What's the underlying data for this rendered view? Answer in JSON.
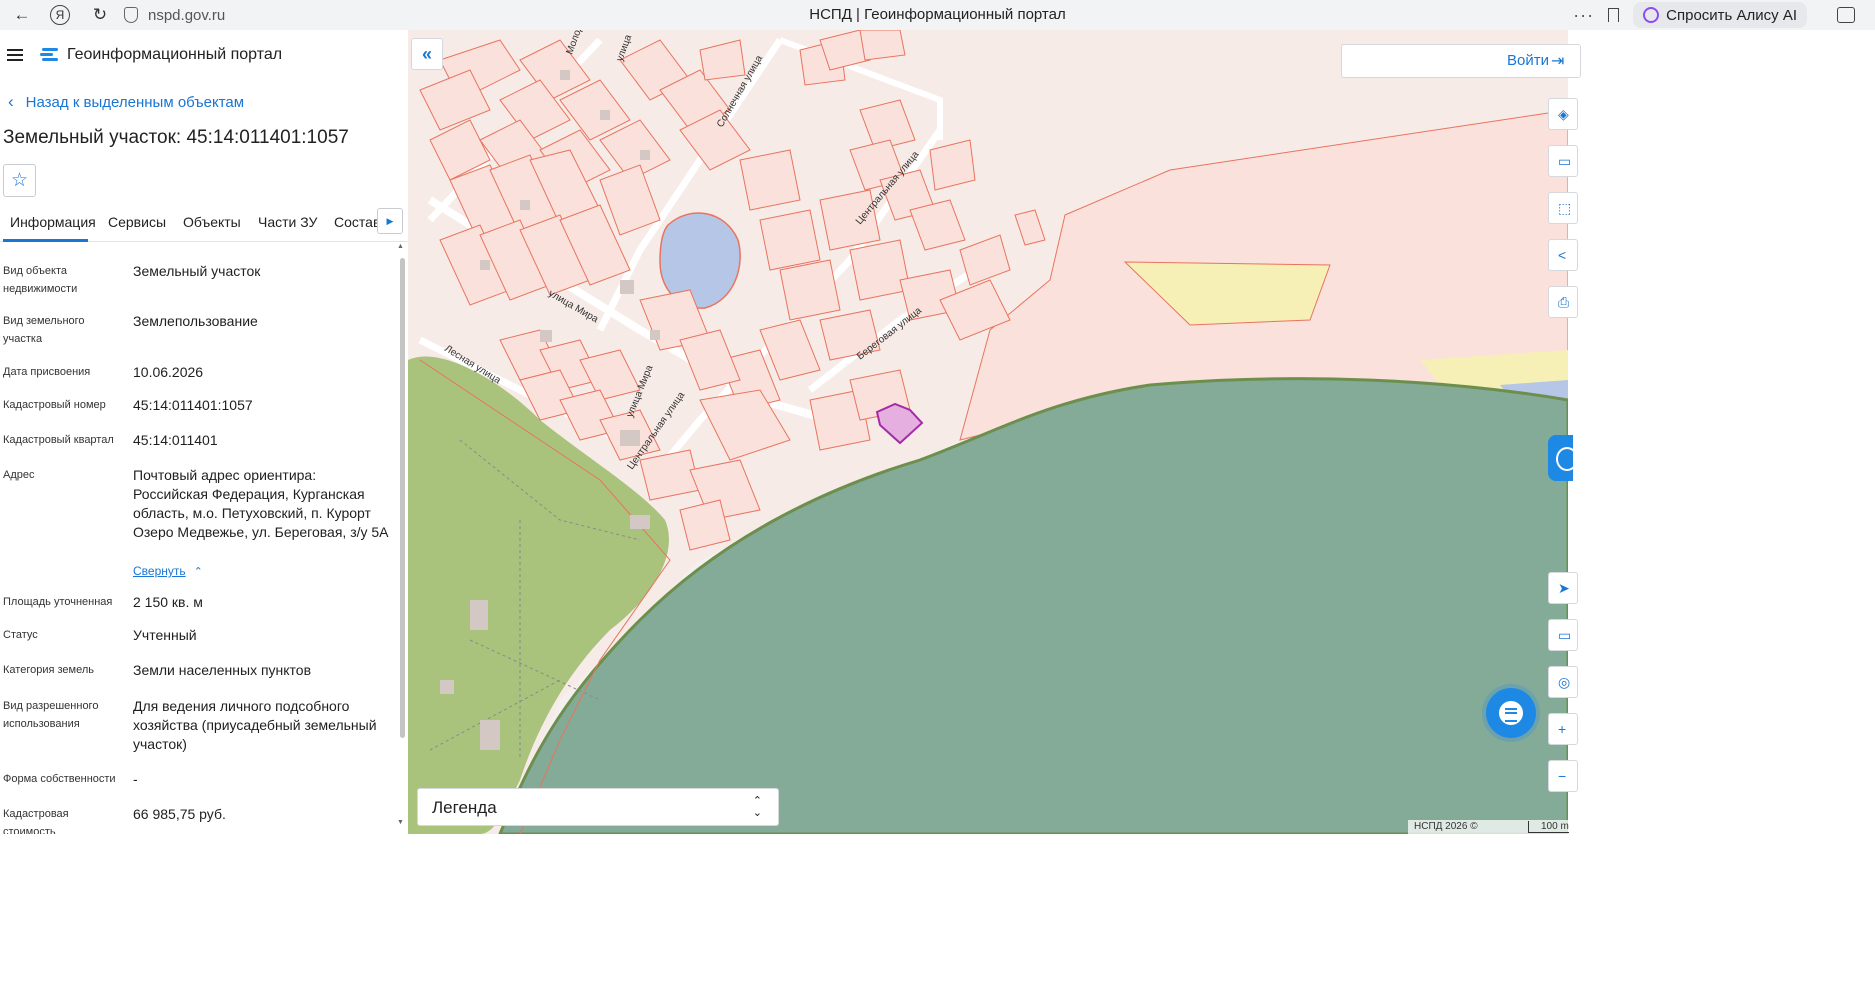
{
  "browser": {
    "back_icon": "arrow-left-icon",
    "url": "nspd.gov.ru",
    "title": "НСПД | Геоинформационный портал",
    "more": "···",
    "alice_label": "Спросить Алису AI"
  },
  "app": {
    "title": "Геоинформационный портал",
    "back_link": "Назад к выделенным объектам",
    "object_title": "Земельный участок: 45:14:011401:1057",
    "star_icon": "☆"
  },
  "tabs": [
    {
      "label": "Информация"
    },
    {
      "label": "Сервисы"
    },
    {
      "label": "Объекты"
    },
    {
      "label": "Части ЗУ"
    },
    {
      "label": "Состав"
    }
  ],
  "info": {
    "object_type": {
      "label": "Вид объекта недвижимости",
      "value": "Земельный участок"
    },
    "land_type": {
      "label": "Вид земельного участка",
      "value": "Землепользование"
    },
    "date": {
      "label": "Дата присвоения",
      "value": "10.06.2026"
    },
    "cad_number": {
      "label": "Кадастровый номер",
      "value": "45:14:011401:1057"
    },
    "cad_quarter": {
      "label": "Кадастровый квартал",
      "value": "45:14:011401"
    },
    "address": {
      "label": "Адрес",
      "value": "Почтовый адрес ориентира: Российская Федерация, Курганская область, м.о. Петуховский, п. Курорт Озеро Медвежье, ул. Береговая, з/у 5А",
      "collapse": "Свернуть"
    },
    "area": {
      "label": "Площадь уточненная",
      "value": "2 150 кв. м"
    },
    "status": {
      "label": "Статус",
      "value": "Учтенный"
    },
    "category": {
      "label": "Категория земель",
      "value": "Земли населенных пунктов"
    },
    "usage": {
      "label": "Вид разрешенного использования",
      "value": "Для ведения личного подсобного хозяйства (приусадебный земельный участок)"
    },
    "ownership": {
      "label": "Форма собственности",
      "value": "-"
    },
    "cad_value": {
      "label": "Кадастровая стоимость",
      "value": "66 985,75 руб."
    }
  },
  "map": {
    "login": "Войти",
    "legend": "Легенда",
    "attribution": "НСПД 2026 ©",
    "scale": "100 m",
    "streets": {
      "s1": "улица Мира",
      "s2": "Лесная улица",
      "s3": "улица Мира",
      "s4": "Центральная улица",
      "s5": "Солнечная улица",
      "s6": "Центральная улица",
      "s7": "Береговая улица",
      "s8": "улица",
      "s9": "Молод"
    },
    "colors": {
      "parcel_fill": "#fbe1dc",
      "parcel_stroke": "#e8745e",
      "water": "#84ab98",
      "park": "#a9c27c",
      "pond": "#b6c6e6",
      "selected": "#a32ca6",
      "yellow_zone": "#f6efb6",
      "link": "#1976d2"
    }
  }
}
